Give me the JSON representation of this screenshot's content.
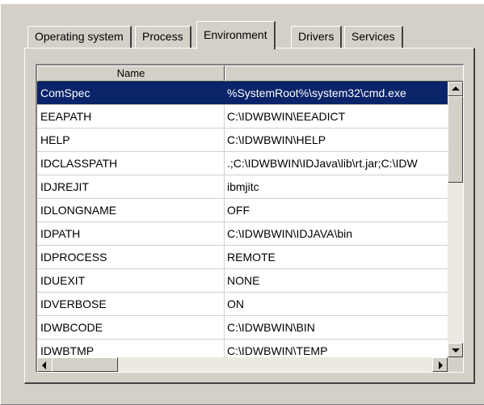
{
  "tabs": [
    {
      "label": "Operating system",
      "active": false
    },
    {
      "label": "Process",
      "active": false
    },
    {
      "label": "Environment",
      "active": true
    },
    {
      "label": "Drivers",
      "active": false
    },
    {
      "label": "Services",
      "active": false
    }
  ],
  "list": {
    "columns": [
      "Name",
      ""
    ],
    "rows": [
      {
        "name": "ComSpec",
        "value": "%SystemRoot%\\system32\\cmd.exe",
        "selected": true
      },
      {
        "name": "EEAPATH",
        "value": "C:\\IDWBWIN\\EEADICT"
      },
      {
        "name": "HELP",
        "value": "C:\\IDWBWIN\\HELP"
      },
      {
        "name": "IDCLASSPATH",
        "value": ".;C:\\IDWBWIN\\IDJava\\lib\\rt.jar;C:\\IDW"
      },
      {
        "name": "IDJREJIT",
        "value": "ibmjitc"
      },
      {
        "name": "IDLONGNAME",
        "value": "OFF"
      },
      {
        "name": "IDPATH",
        "value": "C:\\IDWBWIN\\IDJAVA\\bin"
      },
      {
        "name": "IDPROCESS",
        "value": "REMOTE"
      },
      {
        "name": "IDUEXIT",
        "value": "NONE"
      },
      {
        "name": "IDVERBOSE",
        "value": "ON"
      },
      {
        "name": "IDWBCODE",
        "value": "C:\\IDWBWIN\\BIN"
      },
      {
        "name": "IDWBTMP",
        "value": "C:\\IDWBWIN\\TEMP"
      }
    ]
  },
  "colors": {
    "selection": "#0a246a",
    "face": "#d4d0c8"
  },
  "icons": [
    "scroll-up-icon",
    "scroll-down-icon",
    "scroll-left-icon",
    "scroll-right-icon"
  ]
}
